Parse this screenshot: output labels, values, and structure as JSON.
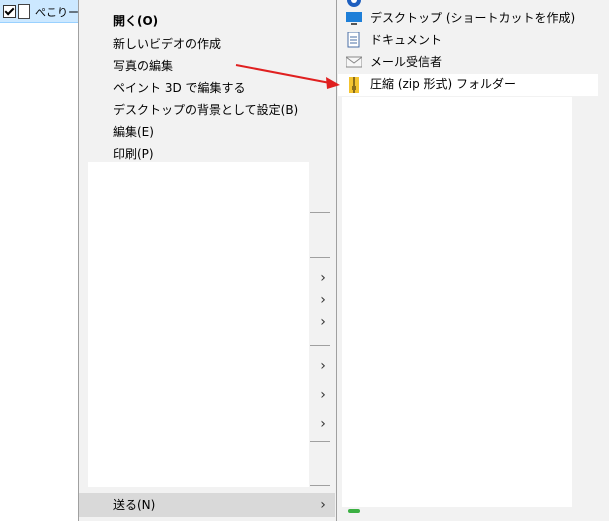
{
  "explorer": {
    "selected_file_name": "ぺこりー絵"
  },
  "context_menu": {
    "items": [
      {
        "label": "開く(O)"
      },
      {
        "label": "新しいビデオの作成"
      },
      {
        "label": "写真の編集"
      },
      {
        "label": "ペイント 3D で編集する"
      },
      {
        "label": "デスクトップの背景として設定(B)"
      },
      {
        "label": "編集(E)"
      },
      {
        "label": "印刷(P)"
      }
    ],
    "send_to_label": "送る(N)"
  },
  "send_to_submenu": {
    "items": [
      {
        "label": "デスクトップ (ショートカットを作成)",
        "icon": "desktop-icon"
      },
      {
        "label": "ドキュメント",
        "icon": "documents-icon"
      },
      {
        "label": "メール受信者",
        "icon": "mail-icon"
      },
      {
        "label": "圧縮 (zip 形式) フォルダー",
        "icon": "zip-folder-icon"
      }
    ]
  },
  "colors": {
    "annotation_arrow": "#e02020",
    "selection_bg": "#cce8ff",
    "menu_bg": "#f2f2f2"
  }
}
